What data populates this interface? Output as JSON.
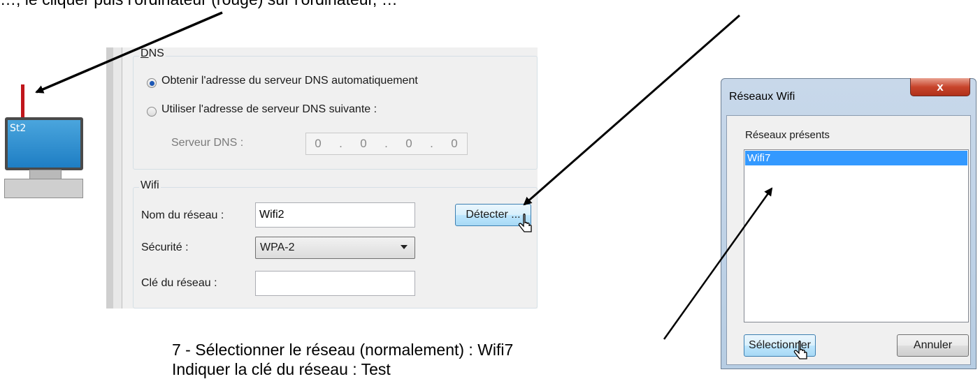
{
  "top_text": "…, le cliquer puis l'ordinateur (rouge) sur l'ordinateur, …",
  "instructions": {
    "line1": "7 - Sélectionner le réseau (normalement) :  Wifi7",
    "line2": "Indiquer la clé du réseau : Test"
  },
  "station": {
    "label": "St2"
  },
  "dns": {
    "group_label": "DNS",
    "radio_auto": "Obtenir l'adresse du serveur DNS automatiquement",
    "radio_manual": "Utiliser l'adresse de serveur DNS suivante :",
    "server_label": "Serveur DNS :",
    "server_octets": [
      "0",
      "0",
      "0",
      "0"
    ]
  },
  "wifi": {
    "group_label": "Wifi",
    "name_label": "Nom du réseau :",
    "name_value": "Wifi2",
    "detect_button": "Détecter ...",
    "security_label": "Sécurité :",
    "security_value": "WPA-2",
    "key_label": "Clé du réseau :",
    "key_value": ""
  },
  "dialog": {
    "title": "Réseaux Wifi",
    "close_glyph": "x",
    "list_label": "Réseaux présents",
    "networks": [
      "Wifi7"
    ],
    "select_button": "Sélectionner",
    "cancel_button": "Annuler"
  },
  "colors": {
    "selection": "#3399ff",
    "antenna": "#c0161b",
    "monitor": "#1e7ec4",
    "radio_dot": "#1c57b5"
  }
}
